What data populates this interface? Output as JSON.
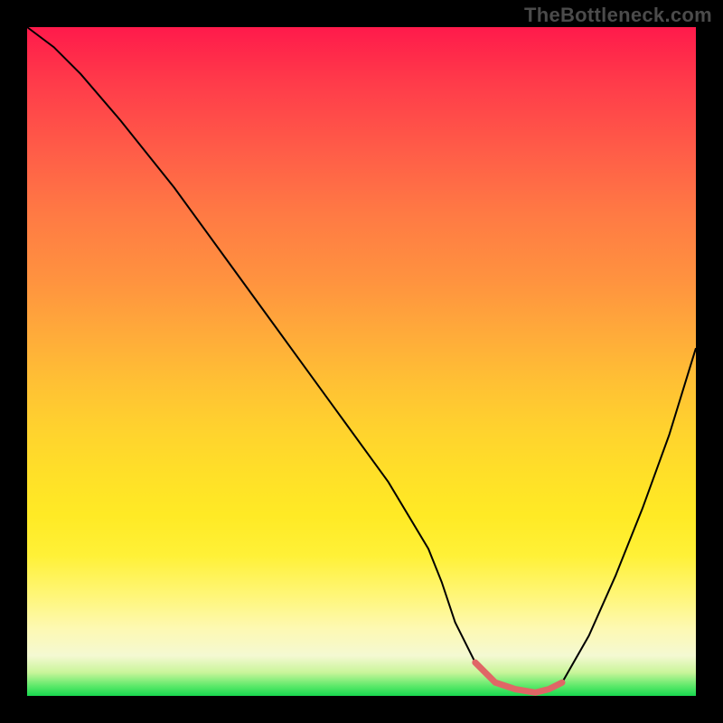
{
  "watermark": "TheBottleneck.com",
  "chart_data": {
    "type": "line",
    "title": "",
    "xlabel": "",
    "ylabel": "",
    "xlim": [
      0,
      100
    ],
    "ylim": [
      0,
      100
    ],
    "grid": false,
    "legend": false,
    "series": [
      {
        "name": "curve",
        "x": [
          0,
          4,
          8,
          14,
          22,
          30,
          38,
          46,
          54,
          60,
          62,
          64,
          67,
          70,
          73,
          76,
          78,
          80,
          84,
          88,
          92,
          96,
          100
        ],
        "y": [
          100,
          97,
          93,
          86,
          76,
          65,
          54,
          43,
          32,
          22,
          17,
          11,
          5,
          2,
          1,
          0.5,
          1,
          2,
          9,
          18,
          28,
          39,
          52
        ]
      },
      {
        "name": "highlight",
        "x": [
          67,
          70,
          73,
          76,
          78,
          80
        ],
        "y": [
          5,
          2,
          1,
          0.5,
          1,
          2
        ]
      }
    ],
    "background_gradient_stops": [
      {
        "pos": 0.0,
        "color": "#ff1a4b"
      },
      {
        "pos": 0.3,
        "color": "#ff7a44"
      },
      {
        "pos": 0.6,
        "color": "#ffd22e"
      },
      {
        "pos": 0.85,
        "color": "#fff678"
      },
      {
        "pos": 0.95,
        "color": "#c9f59a"
      },
      {
        "pos": 1.0,
        "color": "#18d94f"
      }
    ]
  }
}
